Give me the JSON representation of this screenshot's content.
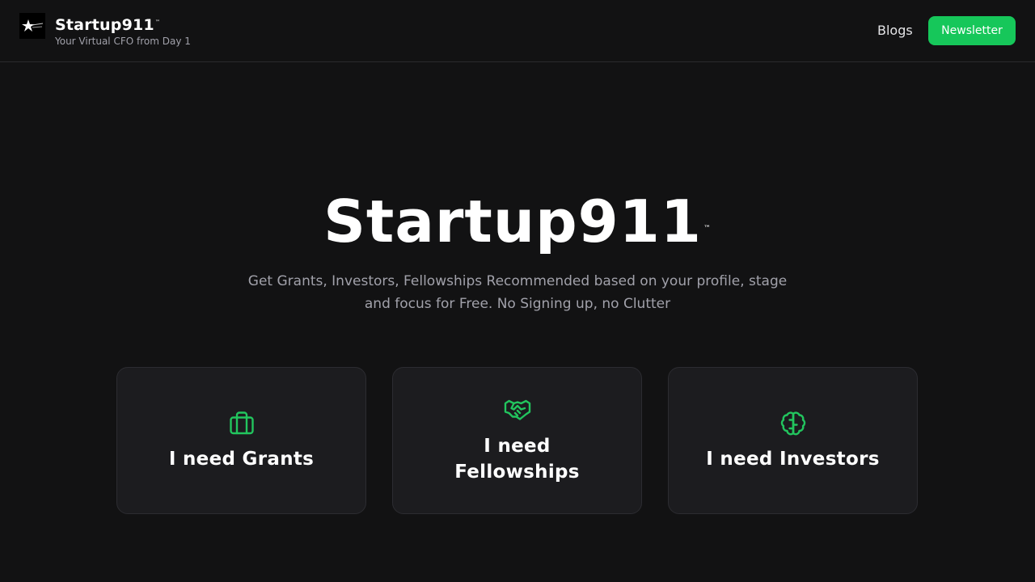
{
  "header": {
    "brand_title": "Startup911",
    "brand_tm": "™",
    "brand_tagline": "Your Virtual CFO from Day 1",
    "nav_blogs": "Blogs",
    "newsletter_label": "Newsletter",
    "logo_icon": "star-logo-icon"
  },
  "hero": {
    "title": "Startup911",
    "tm": "™",
    "subtitle": "Get Grants, Investors, Fellowships Recommended based on your profile, stage and focus for Free. No Signing up, no Clutter"
  },
  "cards": [
    {
      "label": "I need Grants",
      "icon": "briefcase-icon"
    },
    {
      "label": "I need Fellowships",
      "icon": "handshake-icon"
    },
    {
      "label": "I need Investors",
      "icon": "brain-icon"
    }
  ],
  "colors": {
    "background": "#121213",
    "accent": "#16c75a",
    "card_bg": "#1c1c1f",
    "icon_green": "#22c55e"
  }
}
